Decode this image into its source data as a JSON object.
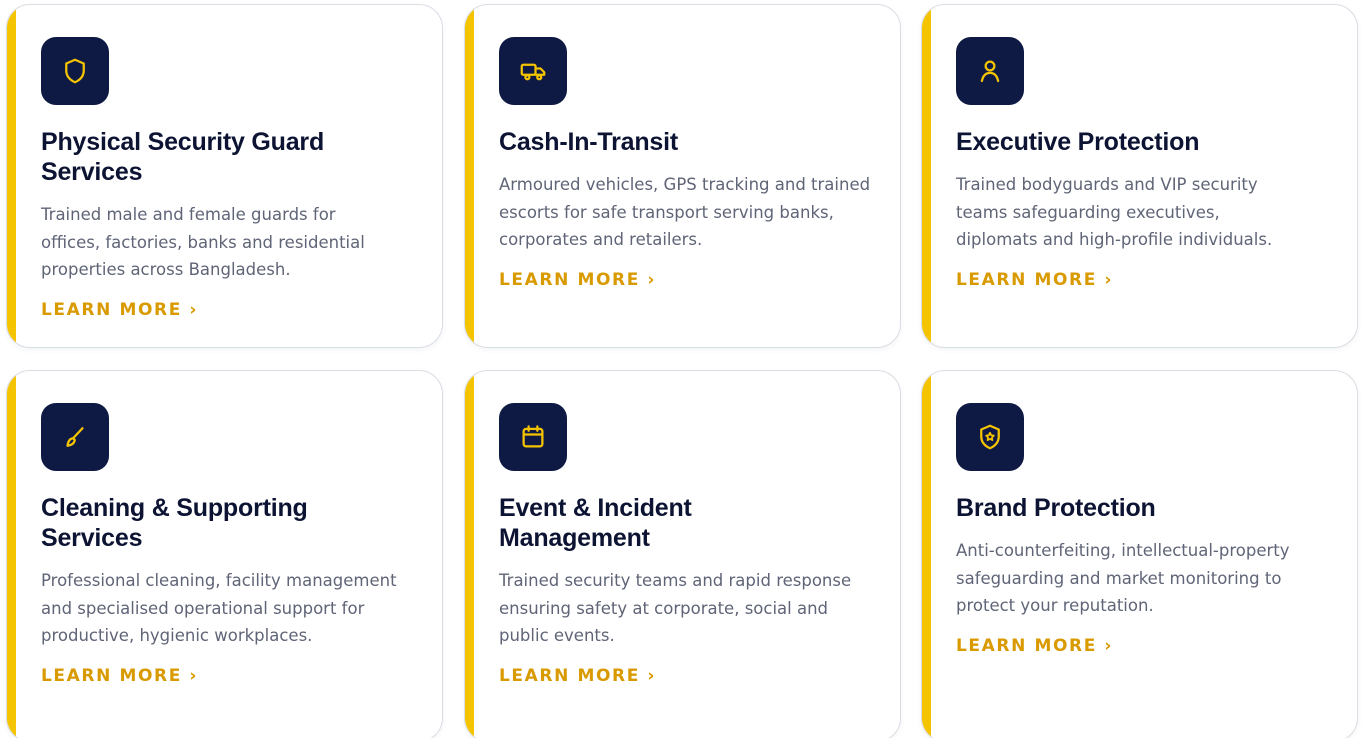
{
  "cards": [
    {
      "icon": "shield-icon",
      "title": "Physical Security Guard Services",
      "description": "Trained male and female guards for offices, factories, banks and residential properties across Bangladesh.",
      "link": "LEARN MORE ›"
    },
    {
      "icon": "truck-icon",
      "title": "Cash-In-Transit",
      "description": "Armoured vehicles, GPS tracking and trained escorts for safe transport serving banks, corporates and retailers.",
      "link": "LEARN MORE ›"
    },
    {
      "icon": "user-icon",
      "title": "Executive Protection",
      "description": "Trained bodyguards and VIP security teams safeguarding executives, diplomats and high-profile individuals.",
      "link": "LEARN MORE ›"
    },
    {
      "icon": "brush-icon",
      "title": "Cleaning & Supporting Services",
      "description": "Professional cleaning, facility management and specialised operational support for productive, hygienic workplaces.",
      "link": "LEARN MORE ›"
    },
    {
      "icon": "calendar-icon",
      "title": "Event & Incident Management",
      "description": "Trained security teams and rapid response ensuring safety at corporate, social and public events.",
      "link": "LEARN MORE ›"
    },
    {
      "icon": "shield-star-icon",
      "title": "Brand Protection",
      "description": "Anti-counterfeiting, intellectual-property safeguarding and market monitoring to protect your reputation.",
      "link": "LEARN MORE ›"
    }
  ],
  "colors": {
    "accent": "#f5c400",
    "icon_background": "#0f1a44",
    "icon_stroke": "#f5c400",
    "title": "#0d1433",
    "description": "#5f6577",
    "link": "#d99a00"
  }
}
